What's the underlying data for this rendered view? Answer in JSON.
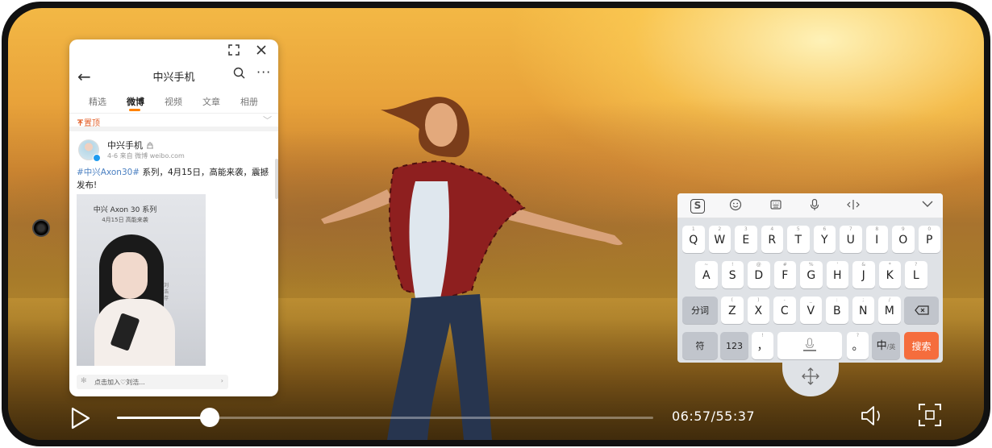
{
  "float_window": {
    "controls": {
      "expand_icon": "expand-icon",
      "close_icon": "close-icon"
    },
    "header": {
      "back_icon": "←",
      "title": "中兴手机",
      "search_icon": "⌕",
      "more_icon": "···"
    },
    "tabs": [
      {
        "label": "精选"
      },
      {
        "label": "微博"
      },
      {
        "label": "视频"
      },
      {
        "label": "文章"
      },
      {
        "label": "相册"
      }
    ],
    "active_tab": "微博",
    "pinned_label": "置顶",
    "post": {
      "author": "中兴手机",
      "meta": "4-6  来自 微博 weibo.com",
      "hashtag": "#中兴Axon30#",
      "text": " 系列，4月15日，高能来袭，震撼发布!",
      "image": {
        "title": "中兴 Axon 30 系列",
        "date": "4月15日   高能来袭",
        "side_text": "刘 浩 存"
      }
    },
    "bottom_bar": {
      "text": "点击加入♡刘浩...",
      "arrow": "›"
    }
  },
  "keyboard": {
    "toolbar": [
      "sogou-logo-icon",
      "emoji-icon",
      "clipboard-icon",
      "microphone-icon",
      "cursor-icon",
      "collapse-icon"
    ],
    "logo_text": "S",
    "row1": [
      {
        "k": "Q",
        "n": "1"
      },
      {
        "k": "W",
        "n": "2"
      },
      {
        "k": "E",
        "n": "3"
      },
      {
        "k": "R",
        "n": "4"
      },
      {
        "k": "T",
        "n": "5"
      },
      {
        "k": "Y",
        "n": "6"
      },
      {
        "k": "U",
        "n": "7"
      },
      {
        "k": "I",
        "n": "8"
      },
      {
        "k": "O",
        "n": "9"
      },
      {
        "k": "P",
        "n": "0"
      }
    ],
    "row2": [
      {
        "k": "A",
        "n": "~"
      },
      {
        "k": "S",
        "n": "!"
      },
      {
        "k": "D",
        "n": "@"
      },
      {
        "k": "F",
        "n": "#"
      },
      {
        "k": "G",
        "n": "%"
      },
      {
        "k": "H",
        "n": "'"
      },
      {
        "k": "J",
        "n": "&"
      },
      {
        "k": "K",
        "n": "*"
      },
      {
        "k": "L",
        "n": "?"
      }
    ],
    "row3_left": "分词",
    "row3": [
      {
        "k": "Z",
        "n": "("
      },
      {
        "k": "X",
        "n": ")"
      },
      {
        "k": "C",
        "n": "-"
      },
      {
        "k": "V",
        "n": "_"
      },
      {
        "k": "B",
        "n": ":"
      },
      {
        "k": "N",
        "n": ";"
      },
      {
        "k": "M",
        "n": "/"
      }
    ],
    "row4": {
      "symbol": "符",
      "numbers": "123",
      "comma": "，",
      "period": "。",
      "lang_main": "中",
      "lang_sub": "/英",
      "search": "搜索"
    }
  },
  "video": {
    "time": "06:57/55:37",
    "progress": 0.173
  }
}
